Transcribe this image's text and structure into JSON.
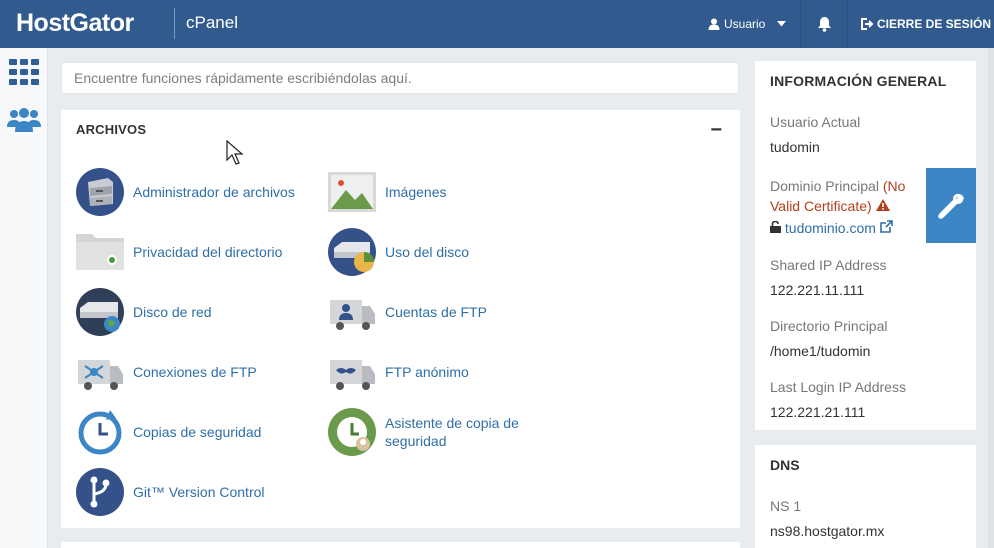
{
  "header": {
    "brand": "HostGator",
    "product": "cPanel",
    "user_label": "Usuario",
    "logout_label": "CIERRE DE SESIÓN",
    "icons": [
      "user-icon",
      "chevron-down-icon",
      "bell-icon",
      "logout-icon"
    ]
  },
  "rail": {
    "icons": [
      "grid-icon",
      "users-icon"
    ]
  },
  "search": {
    "placeholder": "Encuentre funciones rápidamente escribiéndolas aquí."
  },
  "files": {
    "title": "ARCHIVOS",
    "collapse": "−",
    "items": [
      {
        "label": "Administrador de archivos",
        "icon": "file-manager-icon"
      },
      {
        "label": "Imágenes",
        "icon": "images-icon"
      },
      {
        "label": "Privacidad del directorio",
        "icon": "directory-privacy-icon"
      },
      {
        "label": "Uso del disco",
        "icon": "disk-usage-icon"
      },
      {
        "label": "Disco de red",
        "icon": "web-disk-icon"
      },
      {
        "label": "Cuentas de FTP",
        "icon": "ftp-accounts-icon"
      },
      {
        "label": "Conexiones de FTP",
        "icon": "ftp-connections-icon"
      },
      {
        "label": "FTP anónimo",
        "icon": "anonymous-ftp-icon"
      },
      {
        "label": "Copias de seguridad",
        "icon": "backup-icon"
      },
      {
        "label": "Asistente de copia de seguridad",
        "icon": "backup-wizard-icon"
      },
      {
        "label": "Git™ Version Control",
        "icon": "git-icon"
      }
    ]
  },
  "general_info": {
    "title": "INFORMACIÓN GENERAL",
    "current_user_label": "Usuario Actual",
    "current_user": "tudomin",
    "main_domain_label": "Dominio Principal",
    "cert_warning": "(No Valid Certificate)",
    "main_domain": "tudominio.com",
    "shared_ip_label": "Shared IP Address",
    "shared_ip": "122.221.11.111",
    "home_dir_label": "Directorio Principal",
    "home_dir": "/home1/tudomin",
    "last_login_label": "Last Login IP Address",
    "last_login_ip": "122.221.21.111"
  },
  "dns": {
    "title": "DNS",
    "ns1_label": "NS 1",
    "ns1": "ns98.hostgator.mx"
  },
  "colors": {
    "header": "#315a8e",
    "link": "#2f6fa8",
    "accent": "#3d86c6",
    "warning": "#b0401e"
  }
}
